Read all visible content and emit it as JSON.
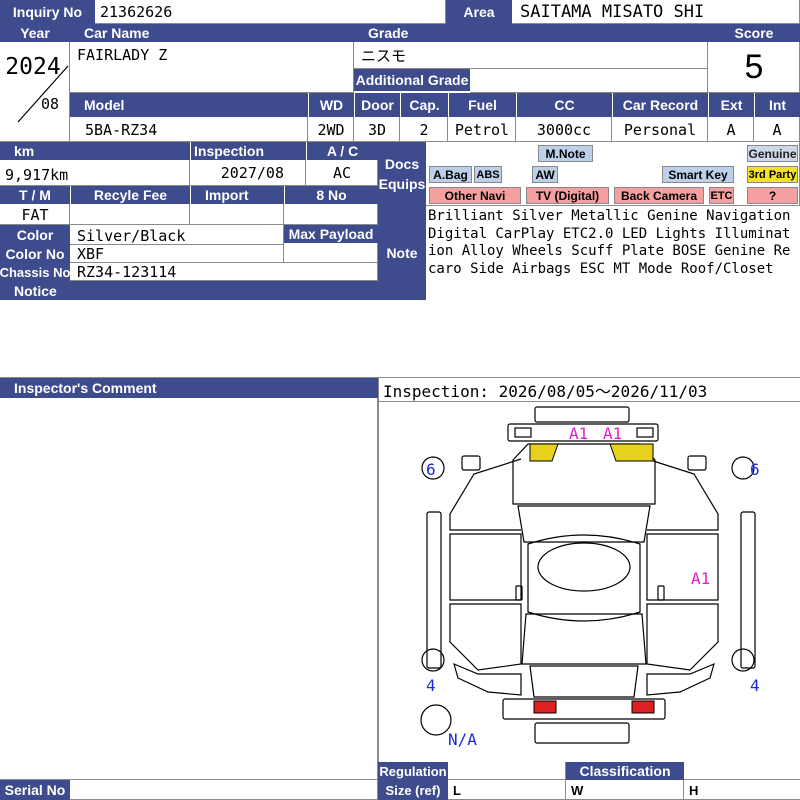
{
  "inquiry": {
    "label": "Inquiry No",
    "value": "21362626"
  },
  "area": {
    "label": "Area",
    "value": "SAITAMA MISATO SHI"
  },
  "year": {
    "label": "Year",
    "value": "2024",
    "month": "08"
  },
  "car_name": {
    "label": "Car Name",
    "value": "FAIRLADY Z"
  },
  "grade": {
    "label": "Grade",
    "value": "ニスモ",
    "additional_label": "Additional Grade",
    "additional_value": ""
  },
  "score": {
    "label": "Score",
    "value": "5"
  },
  "model": {
    "label": "Model",
    "value": "5BA-RZ34"
  },
  "wd": {
    "label": "WD",
    "value": "2WD"
  },
  "door": {
    "label": "Door",
    "value": "3D"
  },
  "cap": {
    "label": "Cap.",
    "value": "2"
  },
  "fuel": {
    "label": "Fuel",
    "value": "Petrol"
  },
  "cc": {
    "label": "CC",
    "value": "3000cc"
  },
  "car_record": {
    "label": "Car Record",
    "value": "Personal"
  },
  "ext": {
    "label": "Ext",
    "value": "A"
  },
  "int": {
    "label": "Int",
    "value": "A"
  },
  "km": {
    "label": "km",
    "value": "9,917km"
  },
  "inspection": {
    "label": "Inspection",
    "value": "2027/08"
  },
  "ac": {
    "label": "A / C",
    "value": "AC"
  },
  "docs": {
    "label1": "Docs",
    "label2": "Equips"
  },
  "tm": {
    "label": "T / M",
    "value": "FAT"
  },
  "recycle_fee": {
    "label": "Recyle Fee",
    "value": ""
  },
  "import": {
    "label": "Import",
    "value": ""
  },
  "eight_no": {
    "label": "8 No",
    "value": ""
  },
  "color": {
    "label": "Color",
    "value": "Silver/Black"
  },
  "max_payload": {
    "label": "Max Payload",
    "value": ""
  },
  "color_no": {
    "label": "Color No",
    "value": "XBF"
  },
  "chassis_no": {
    "label": "Chassis No",
    "value": "RZ34-123114"
  },
  "notice": {
    "label": "Notice",
    "value": ""
  },
  "note": {
    "label": "Note",
    "value": "Brilliant Silver Metallic Genine Navigation Digital CarPlay ETC2.0 LED Lights Illumination Alloy Wheels Scuff Plate BOSE Genine Recaro Side Airbags ESC MT Mode Roof/Closet"
  },
  "badges": {
    "mnote": "M.Note",
    "genuine": "Genuine",
    "abag": "A.Bag",
    "abs": "ABS",
    "aw": "AW",
    "smart_key": "Smart Key",
    "third_party": "3rd Party",
    "other_navi": "Other Navi",
    "tv": "TV (Digital)",
    "back_camera": "Back Camera",
    "etc": "ETC",
    "unknown": "?"
  },
  "inspector": {
    "label": "Inspector's Comment",
    "value": ""
  },
  "inspection_period": "Inspection: 2026/08/05〜2026/11/03",
  "diagram": {
    "front_left": "A1",
    "front_right": "A1",
    "side_right": "A1",
    "tl": "6",
    "tr": "6",
    "bl": "4",
    "br": "4",
    "na": "N/A"
  },
  "regulation": {
    "label": "Regulation",
    "value": ""
  },
  "classification": {
    "label": "Classification",
    "value": ""
  },
  "size": {
    "label": "Size (ref)",
    "l": "L",
    "w": "W",
    "h": "H"
  },
  "serial_no": {
    "label": "Serial No",
    "value": ""
  },
  "colors": {
    "header": "#3e4b8c",
    "damage": "#e6d21a",
    "lamp": "#e02020",
    "mark_pink": "#e020d0",
    "mark_blue": "#1a2ad0"
  }
}
